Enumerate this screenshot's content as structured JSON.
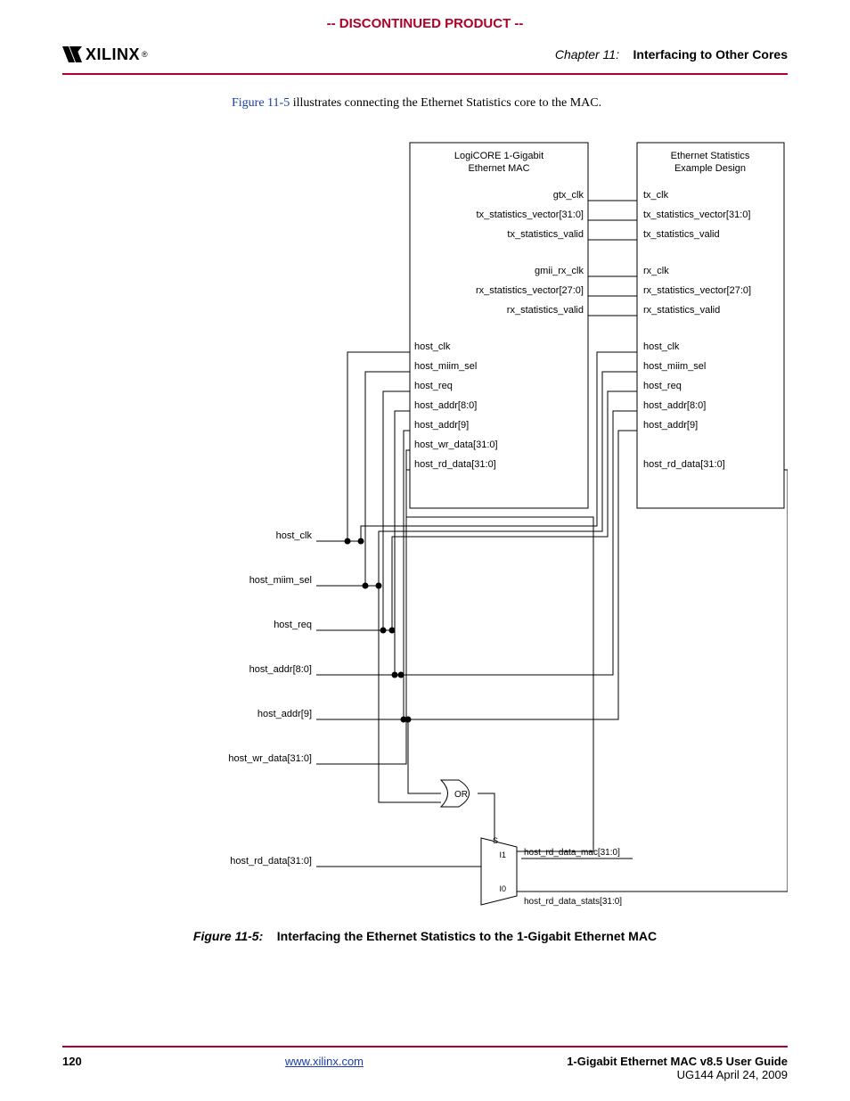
{
  "banner": "-- DISCONTINUED PRODUCT --",
  "logo_text": "XILINX",
  "chapter_label": "Chapter 11:",
  "chapter_title": "Interfacing to Other Cores",
  "intro_ref": "Figure 11-5",
  "intro_rest": " illustrates connecting the Ethernet Statistics core to the MAC.",
  "diagram": {
    "box_left_l1": "LogiCORE 1-Gigabit",
    "box_left_l2": "Ethernet MAC",
    "box_right_l1": "Ethernet Statistics",
    "box_right_l2": "Example Design",
    "left_sigs_group1": [
      "gtx_clk",
      "tx_statistics_vector[31:0]",
      "tx_statistics_valid"
    ],
    "right_sigs_group1": [
      "tx_clk",
      "tx_statistics_vector[31:0]",
      "tx_statistics_valid"
    ],
    "left_sigs_group2": [
      "gmii_rx_clk",
      "rx_statistics_vector[27:0]",
      "rx_statistics_valid"
    ],
    "right_sigs_group2": [
      "rx_clk",
      "rx_statistics_vector[27:0]",
      "rx_statistics_valid"
    ],
    "left_sigs_group3": [
      "host_clk",
      "host_miim_sel",
      "host_req",
      "host_addr[8:0]",
      "host_addr[9]",
      "host_wr_data[31:0]",
      "host_rd_data[31:0]"
    ],
    "right_sigs_group3": [
      "host_clk",
      "host_miim_sel",
      "host_req",
      "host_addr[8:0]",
      "host_addr[9]",
      "",
      "host_rd_data[31:0]"
    ],
    "ext_sigs": [
      "host_clk",
      "host_miim_sel",
      "host_req",
      "host_addr[8:0]",
      "host_addr[9]",
      "host_wr_data[31:0]"
    ],
    "ext_out": "host_rd_data[31:0]",
    "or_label": "OR",
    "mux_s": "S",
    "mux_i1": "I1",
    "mux_i0": "I0",
    "mux_i1_label": "host_rd_data_mac[31:0]",
    "mux_i0_label": "host_rd_data_stats[31:0]"
  },
  "fig_num": "Figure 11-5:",
  "fig_title": "Interfacing the Ethernet Statistics to the 1-Gigabit Ethernet MAC",
  "page_num": "120",
  "footer_link": "www.xilinx.com",
  "footer_title": "1-Gigabit Ethernet MAC v8.5 User Guide",
  "footer_sub": "UG144 April 24, 2009"
}
